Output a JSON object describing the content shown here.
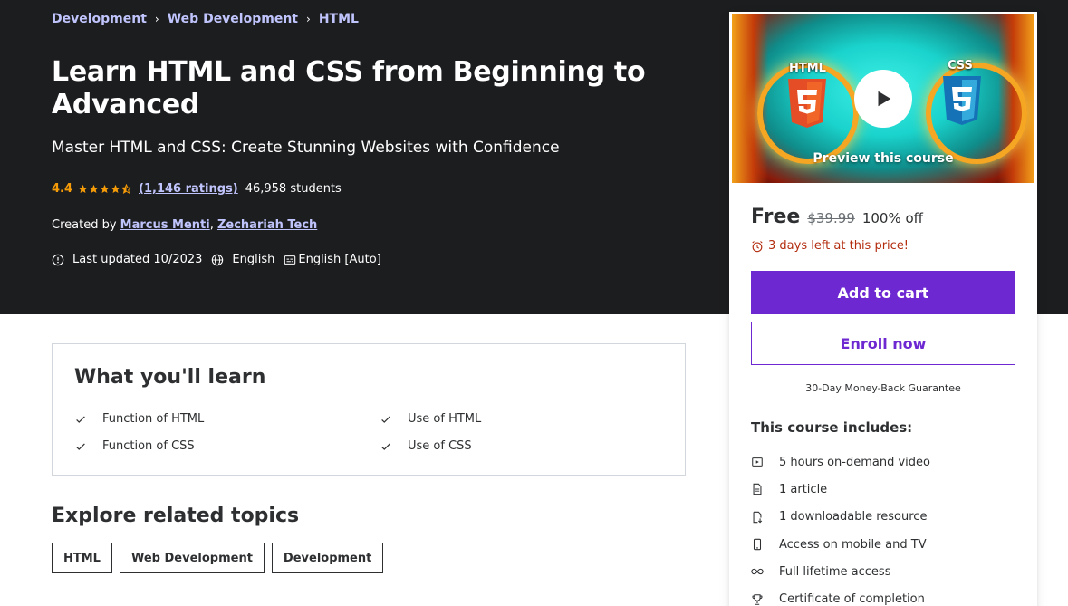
{
  "breadcrumb": [
    "Development",
    "Web Development",
    "HTML"
  ],
  "course": {
    "title": "Learn HTML and CSS from Beginning to Advanced",
    "subtitle": "Master HTML and CSS: Create Stunning Websites with Confidence",
    "rating": "4.4",
    "ratings_count": "(1,146 ratings)",
    "students": "46,958 students",
    "created_by_label": "Created by",
    "instructors": [
      "Marcus Menti",
      "Zechariah Tech"
    ],
    "last_updated": "Last updated 10/2023",
    "language": "English",
    "captions": "English [Auto]"
  },
  "preview": {
    "label": "Preview this course",
    "badge_left": "HTML",
    "badge_right": "CSS"
  },
  "pricing": {
    "current": "Free",
    "original": "$39.99",
    "discount": "100% off",
    "timer": "3 days left at this price!",
    "add_to_cart": "Add to cart",
    "enroll_now": "Enroll now",
    "guarantee": "30-Day Money-Back Guarantee"
  },
  "includes": {
    "title": "This course includes:",
    "items": [
      {
        "icon": "video-icon",
        "label": "5 hours on-demand video"
      },
      {
        "icon": "article-icon",
        "label": "1 article"
      },
      {
        "icon": "download-icon",
        "label": "1 downloadable resource"
      },
      {
        "icon": "mobile-icon",
        "label": "Access on mobile and TV"
      },
      {
        "icon": "infinity-icon",
        "label": "Full lifetime access"
      },
      {
        "icon": "trophy-icon",
        "label": "Certificate of completion"
      }
    ]
  },
  "learn": {
    "title": "What you'll learn",
    "items": [
      "Function of HTML",
      "Use of HTML",
      "Function of CSS",
      "Use of CSS"
    ]
  },
  "related": {
    "title": "Explore related topics",
    "topics": [
      "HTML",
      "Web Development",
      "Development"
    ]
  },
  "colors": {
    "hero_bg": "#1c1d1f",
    "link": "#c0c4fc",
    "star": "#f69c08",
    "primary": "#6d28d2",
    "timer": "#b32d0f"
  }
}
